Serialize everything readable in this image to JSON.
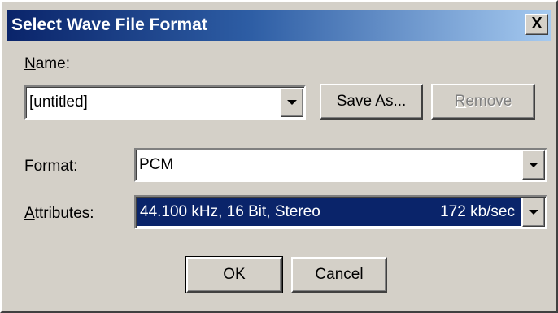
{
  "window": {
    "title": "Select Wave File Format",
    "close_glyph": "X"
  },
  "name_field": {
    "label": "Name:",
    "value": "[untitled]"
  },
  "buttons": {
    "save_as": "Save As...",
    "remove": "Remove",
    "ok": "OK",
    "cancel": "Cancel"
  },
  "format_field": {
    "label": "Format:",
    "value": "PCM"
  },
  "attributes_field": {
    "label": "Attributes:",
    "value": "44.100 kHz, 16 Bit, Stereo",
    "rate": "172 kb/sec"
  },
  "colors": {
    "title_bar_start": "#0a246a",
    "title_bar_end": "#a6caf0",
    "dialog_face": "#d4d0c8",
    "selection": "#0a246a"
  },
  "icons": {
    "dropdown": "chevron-down-icon",
    "close": "close-icon"
  }
}
